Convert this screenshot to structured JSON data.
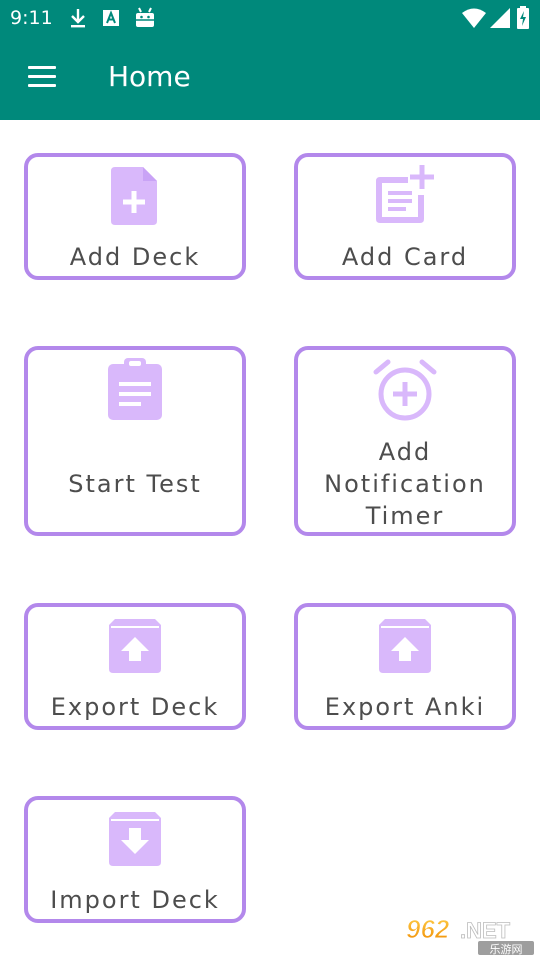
{
  "status_bar": {
    "time": "9:11",
    "left_icons": [
      "download-icon",
      "font-a-icon",
      "android-icon"
    ],
    "right_icons": [
      "wifi-icon",
      "cell-signal-icon",
      "battery-charging-icon"
    ]
  },
  "app_bar": {
    "menu_icon": "hamburger-menu-icon",
    "title": "Home"
  },
  "colors": {
    "primary": "#00897b",
    "card_border": "#b388eb",
    "icon_fill": "#d9b8fb"
  },
  "tiles": [
    {
      "label": "Add Deck",
      "icon": "add-file-icon"
    },
    {
      "label": "Add Card",
      "icon": "note-add-icon"
    },
    {
      "label": "Start Test",
      "icon": "clipboard-icon"
    },
    {
      "label_lines": [
        "Add",
        "Notification",
        "Timer"
      ],
      "icon": "alarm-add-icon"
    },
    {
      "label": "Export Deck",
      "icon": "box-upload-icon"
    },
    {
      "label": "Export Anki",
      "icon": "box-upload-icon"
    },
    {
      "label": "Import Deck",
      "icon": "box-download-icon"
    }
  ],
  "watermark": {
    "logo_text": "962.NET",
    "sub_text": "乐游网"
  }
}
